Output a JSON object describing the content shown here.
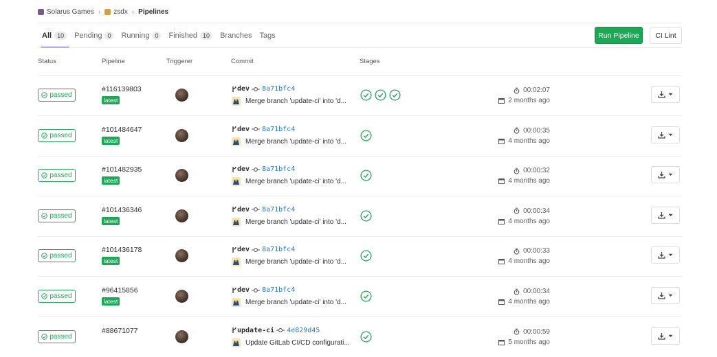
{
  "breadcrumb": [
    {
      "label": "Solarus Games",
      "logo_color": "#7a5a8a"
    },
    {
      "label": "zsdx",
      "logo_color": "#d4a13a"
    },
    {
      "label": "Pipelines"
    }
  ],
  "tabs": [
    {
      "label": "All",
      "count": "10",
      "active": true
    },
    {
      "label": "Pending",
      "count": "0"
    },
    {
      "label": "Running",
      "count": "0"
    },
    {
      "label": "Finished",
      "count": "10"
    },
    {
      "label": "Branches"
    },
    {
      "label": "Tags"
    }
  ],
  "buttons": {
    "run_pipeline": "Run Pipeline",
    "ci_lint": "CI Lint"
  },
  "table": {
    "headers": {
      "status": "Status",
      "pipeline": "Pipeline",
      "triggerer": "Triggerer",
      "commit": "Commit",
      "stages": "Stages"
    },
    "rows": [
      {
        "status": "passed",
        "id": "#116139803",
        "latest": "latest",
        "branch": "dev",
        "sha": "8a71bfc4",
        "message": "Merge branch 'update-ci' into 'd...",
        "stages": 3,
        "duration": "00:02:07",
        "when": "2 months ago"
      },
      {
        "status": "passed",
        "id": "#101484647",
        "latest": "latest",
        "branch": "dev",
        "sha": "8a71bfc4",
        "message": "Merge branch 'update-ci' into 'd...",
        "stages": 1,
        "duration": "00:00:35",
        "when": "4 months ago"
      },
      {
        "status": "passed",
        "id": "#101482935",
        "latest": "latest",
        "branch": "dev",
        "sha": "8a71bfc4",
        "message": "Merge branch 'update-ci' into 'd...",
        "stages": 1,
        "duration": "00:00:32",
        "when": "4 months ago"
      },
      {
        "status": "passed",
        "id": "#101436346",
        "latest": "latest",
        "branch": "dev",
        "sha": "8a71bfc4",
        "message": "Merge branch 'update-ci' into 'd...",
        "stages": 1,
        "duration": "00:00:34",
        "when": "4 months ago"
      },
      {
        "status": "passed",
        "id": "#101436178",
        "latest": "latest",
        "branch": "dev",
        "sha": "8a71bfc4",
        "message": "Merge branch 'update-ci' into 'd...",
        "stages": 1,
        "duration": "00:00:33",
        "when": "4 months ago"
      },
      {
        "status": "passed",
        "id": "#96415856",
        "latest": "latest",
        "branch": "dev",
        "sha": "8a71bfc4",
        "message": "Merge branch 'update-ci' into 'd...",
        "stages": 1,
        "duration": "00:00:34",
        "when": "4 months ago"
      },
      {
        "status": "passed",
        "id": "#88671077",
        "latest": "",
        "branch": "update-ci",
        "sha": "4e829d45",
        "message": "Update GitLab CI/CD configurati...",
        "stages": 1,
        "duration": "00:00:59",
        "when": "5 months ago"
      }
    ]
  },
  "icons": {
    "status": "check-circle-icon",
    "branch": "branch-icon",
    "commit": "commit-icon",
    "timer": "timer-icon",
    "calendar": "calendar-icon",
    "download": "download-icon",
    "caret": "caret-down-icon"
  },
  "colors": {
    "success": "#1aaa55",
    "active_tab": "#6b4fbb",
    "sha": "#1f78d1"
  }
}
